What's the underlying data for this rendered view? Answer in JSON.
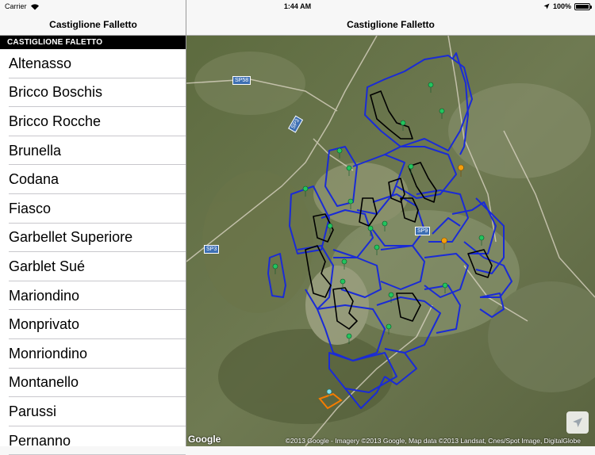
{
  "status_bar": {
    "carrier": "Carrier",
    "time": "1:44 AM",
    "battery": "100%",
    "battery_level": 1.0
  },
  "master": {
    "title": "Castiglione Falletto",
    "section_header": "CASTIGLIONE FALETTO",
    "items": [
      {
        "label": "Altenasso"
      },
      {
        "label": "Bricco Boschis"
      },
      {
        "label": "Bricco Rocche"
      },
      {
        "label": "Brunella"
      },
      {
        "label": "Codana"
      },
      {
        "label": "Fiasco"
      },
      {
        "label": "Garbellet Superiore"
      },
      {
        "label": "Garblet Sué"
      },
      {
        "label": "Mariondino"
      },
      {
        "label": "Monprivato"
      },
      {
        "label": "Monriondino"
      },
      {
        "label": "Montanello"
      },
      {
        "label": "Parussi"
      },
      {
        "label": "Pernanno"
      }
    ]
  },
  "detail": {
    "title": "Castiglione Falletto",
    "map": {
      "road_labels": [
        "SP58",
        "SP3",
        "SP3",
        "SP9"
      ],
      "google_logo": "Google",
      "attribution": "©2013 Google - Imagery ©2013 Google, Map data ©2013 Landsat, Cnes/Spot Image, DigitalGlobe",
      "icons": {
        "location_button": "location-arrow-icon",
        "pin": "map-pin-icon"
      },
      "colors": {
        "boundary": "#1a2bd6",
        "highlight": "#000000",
        "pin": "#22c55e",
        "selected_pin": "#f59e0b",
        "parcel": "#f57c00"
      }
    }
  }
}
